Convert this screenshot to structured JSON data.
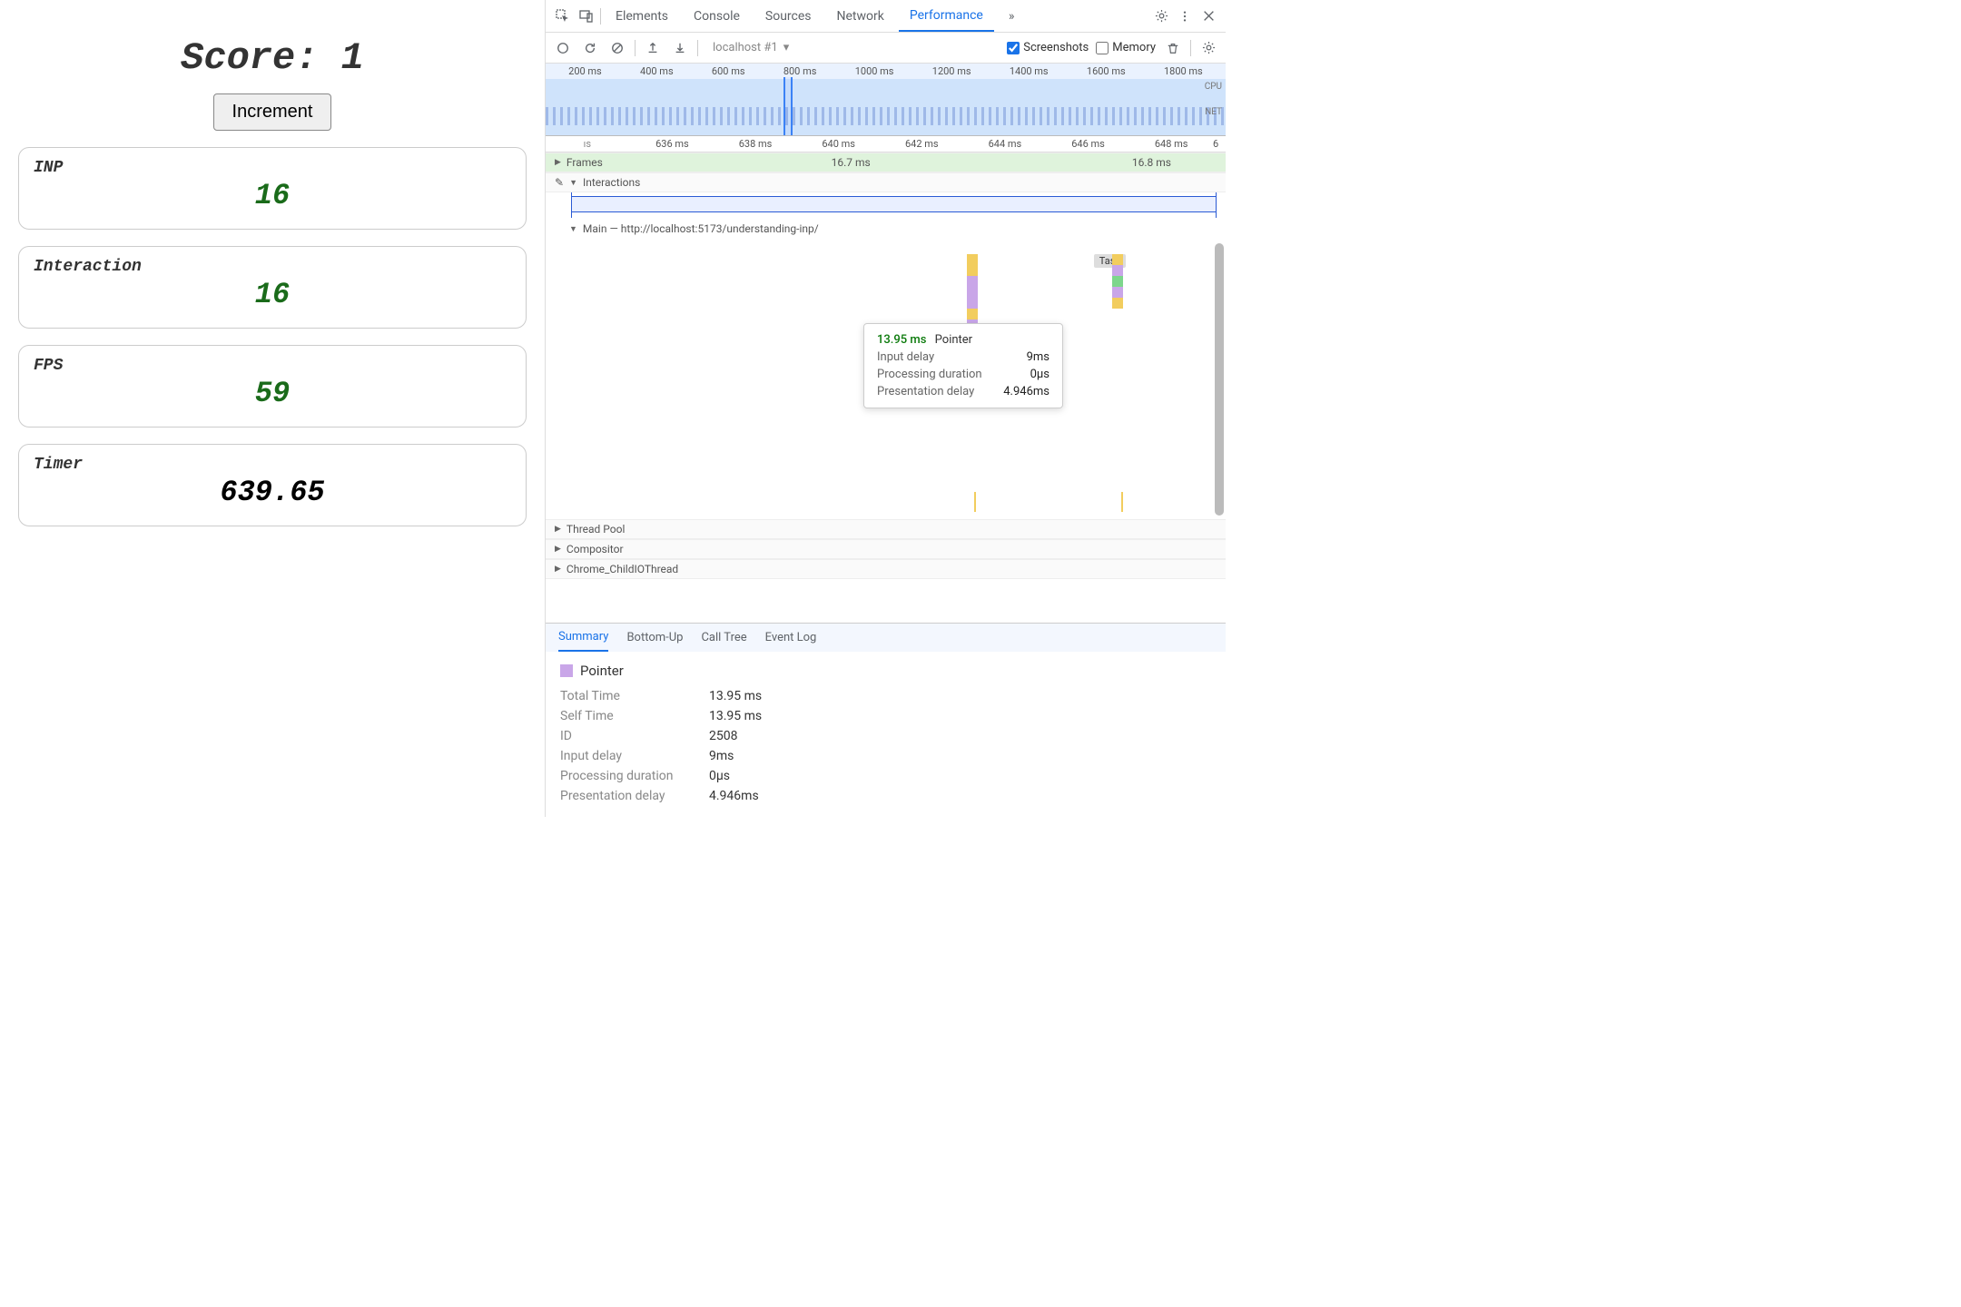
{
  "app": {
    "score_label": "Score: ",
    "score_value": "1",
    "increment_label": "Increment",
    "metrics": [
      {
        "label": "INP",
        "value": "16",
        "green": true
      },
      {
        "label": "Interaction",
        "value": "16",
        "green": true
      },
      {
        "label": "FPS",
        "value": "59",
        "green": true
      },
      {
        "label": "Timer",
        "value": "639.65",
        "green": false
      }
    ]
  },
  "devtools": {
    "tabs": [
      "Elements",
      "Console",
      "Sources",
      "Network",
      "Performance"
    ],
    "active_tab": "Performance",
    "more_chevron": "»",
    "toolbar": {
      "profile_select": "localhost #1",
      "screenshots_label": "Screenshots",
      "memory_label": "Memory"
    },
    "overview_axis": [
      "200 ms",
      "400 ms",
      "600 ms",
      "800 ms",
      "1000 ms",
      "1200 ms",
      "1400 ms",
      "1600 ms",
      "1800 ms"
    ],
    "overview_cpu": "CPU",
    "overview_net": "NET",
    "ruler_start": "ıs",
    "ruler": [
      "636 ms",
      "638 ms",
      "640 ms",
      "642 ms",
      "644 ms",
      "646 ms",
      "648 ms"
    ],
    "ruler_end": "6",
    "tracks": {
      "frames_label": "Frames",
      "frames_val1": "16.7 ms",
      "frames_val2": "16.8 ms",
      "interactions_label": "Interactions",
      "main_label": "Main — http://localhost:5173/understanding-inp/",
      "task_label": "Task",
      "threadpool_label": "Thread Pool",
      "compositor_label": "Compositor",
      "childio_label": "Chrome_ChildIOThread"
    },
    "tooltip": {
      "time": "13.95 ms",
      "type": "Pointer",
      "rows": [
        {
          "k": "Input delay",
          "v": "9ms"
        },
        {
          "k": "Processing duration",
          "v": "0µs"
        },
        {
          "k": "Presentation delay",
          "v": "4.946ms"
        }
      ]
    },
    "detail_tabs": [
      "Summary",
      "Bottom-Up",
      "Call Tree",
      "Event Log"
    ],
    "detail_active": "Summary",
    "summary": {
      "title": "Pointer",
      "rows": [
        {
          "k": "Total Time",
          "v": "13.95 ms"
        },
        {
          "k": "Self Time",
          "v": "13.95 ms"
        },
        {
          "k": "ID",
          "v": "2508"
        },
        {
          "k": "Input delay",
          "v": "9ms"
        },
        {
          "k": "Processing duration",
          "v": "0µs"
        },
        {
          "k": "Presentation delay",
          "v": "4.946ms"
        }
      ]
    }
  }
}
